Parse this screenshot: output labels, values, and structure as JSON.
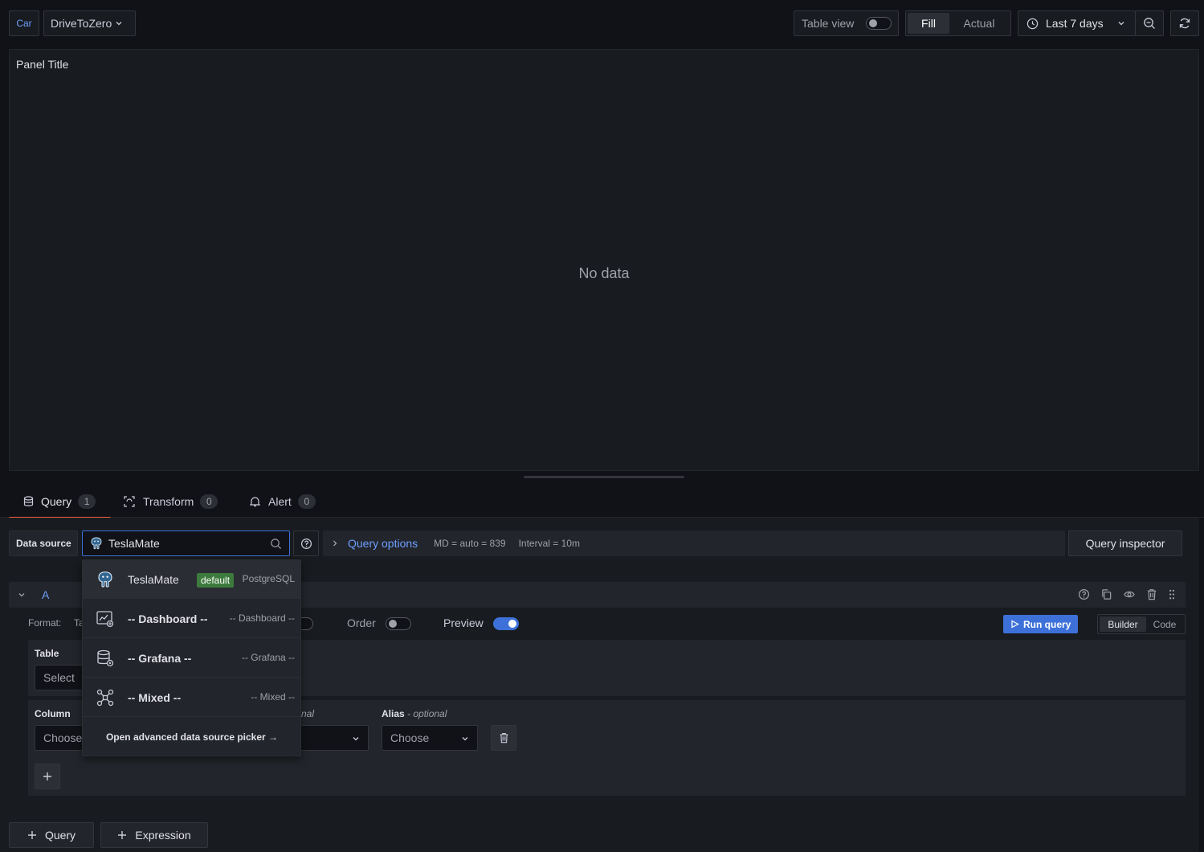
{
  "toolbar": {
    "scope_label": "Car",
    "dashboard_name": "DriveToZero",
    "table_view_label": "Table view",
    "fill_label": "Fill",
    "actual_label": "Actual",
    "time_range_label": "Last 7 days"
  },
  "panel": {
    "title": "Panel Title",
    "empty_text": "No data"
  },
  "tabs": [
    {
      "label": "Query",
      "count": "1"
    },
    {
      "label": "Transform",
      "count": "0"
    },
    {
      "label": "Alert",
      "count": "0"
    }
  ],
  "datasource": {
    "label": "Data source",
    "value": "TeslaMate",
    "query_options_label": "Query options",
    "md_text": "MD = auto = 839",
    "interval_text": "Interval = 10m",
    "query_inspector_label": "Query inspector"
  },
  "dropdown": {
    "items": [
      {
        "name": "TeslaMate",
        "badge": "default",
        "type": "PostgreSQL",
        "icon": "postgresql-icon"
      },
      {
        "name": "-- Dashboard --",
        "badge": "",
        "type": "-- Dashboard --",
        "icon": "dashboard-datasource-icon"
      },
      {
        "name": "-- Grafana --",
        "badge": "",
        "type": "-- Grafana --",
        "icon": "grafana-datasource-icon"
      },
      {
        "name": "-- Mixed --",
        "badge": "",
        "type": "-- Mixed --",
        "icon": "mixed-datasource-icon"
      }
    ],
    "advanced_link": "Open advanced data source picker →"
  },
  "query_row": {
    "ref_id": "A",
    "format_label": "Format:",
    "format_value_partial": "Ta",
    "order_label": "Order",
    "preview_label": "Preview",
    "run_query_label": "Run query",
    "builder_label": "Builder",
    "code_label": "Code",
    "table_label": "Table",
    "table_select_placeholder": "Select",
    "column_label": "Column",
    "column_choose_placeholder": "Choose",
    "aggregation_optional_partial": "nal",
    "alias_label": "Alias",
    "alias_optional": "- optional",
    "alias_choose_placeholder": "Choose"
  },
  "bottom": {
    "add_query_label": "Query",
    "add_expression_label": "Expression"
  },
  "colors": {
    "accent_blue": "#6e9fff",
    "primary_button": "#3d71d9",
    "tab_underline": "#f55f3e",
    "default_badge": "#3d7a3d"
  }
}
